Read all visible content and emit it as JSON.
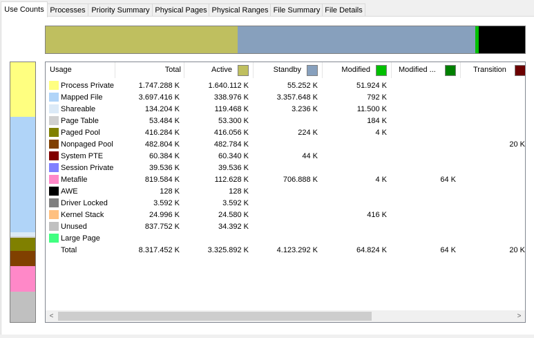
{
  "tabs": [
    {
      "label": "Use Counts",
      "active": true
    },
    {
      "label": "Processes"
    },
    {
      "label": "Priority Summary"
    },
    {
      "label": "Physical Pages"
    },
    {
      "label": "Physical Ranges"
    },
    {
      "label": "File Summary"
    },
    {
      "label": "File Details"
    }
  ],
  "usage_bar": [
    {
      "name": "Active",
      "fraction": 0.4,
      "color": "#bfbf5f"
    },
    {
      "name": "Standby",
      "fraction": 0.496,
      "color": "#87a0bd"
    },
    {
      "name": "Modified",
      "fraction": 0.008,
      "color": "#00c000"
    },
    {
      "name": "Free",
      "fraction": 0.096,
      "color": "#000000"
    }
  ],
  "side_bar": [
    {
      "name": "Process Private",
      "fraction": 0.21,
      "color": "#ffff80"
    },
    {
      "name": "Mapped File",
      "fraction": 0.444,
      "color": "#b0d4f8"
    },
    {
      "name": "Shareable",
      "fraction": 0.016,
      "color": "#dceaf7"
    },
    {
      "name": "Page Table",
      "fraction": 0.006,
      "color": "#d0d0d0"
    },
    {
      "name": "Paged Pool",
      "fraction": 0.05,
      "color": "#808000"
    },
    {
      "name": "Nonpaged Pool",
      "fraction": 0.058,
      "color": "#804000"
    },
    {
      "name": "Metafile",
      "fraction": 0.098,
      "color": "#ff88c8"
    },
    {
      "name": "Unused",
      "fraction": 0.118,
      "color": "#c0c0c0"
    }
  ],
  "columns": [
    {
      "label": "Usage",
      "swatch": null
    },
    {
      "label": "Total",
      "swatch": null
    },
    {
      "label": "Active",
      "swatch": "#bfbf5f"
    },
    {
      "label": "Standby",
      "swatch": "#87a0bd"
    },
    {
      "label": "Modified",
      "swatch": "#00c000"
    },
    {
      "label": "Modified ...",
      "swatch": "#008000"
    },
    {
      "label": "Transition",
      "swatch": "#6b0000"
    }
  ],
  "rows": [
    {
      "name": "Process Private",
      "color": "#ffff80",
      "total": "1.747.288 K",
      "active": "1.640.112 K",
      "standby": "55.252 K",
      "modified": "51.924 K",
      "modnw": "",
      "transition": ""
    },
    {
      "name": "Mapped File",
      "color": "#b0d4f8",
      "total": "3.697.416 K",
      "active": "338.976 K",
      "standby": "3.357.648 K",
      "modified": "792 K",
      "modnw": "",
      "transition": ""
    },
    {
      "name": "Shareable",
      "color": "#dceaf7",
      "total": "134.204 K",
      "active": "119.468 K",
      "standby": "3.236 K",
      "modified": "11.500 K",
      "modnw": "",
      "transition": ""
    },
    {
      "name": "Page Table",
      "color": "#d0d0d0",
      "total": "53.484 K",
      "active": "53.300 K",
      "standby": "",
      "modified": "184 K",
      "modnw": "",
      "transition": ""
    },
    {
      "name": "Paged Pool",
      "color": "#808000",
      "total": "416.284 K",
      "active": "416.056 K",
      "standby": "224 K",
      "modified": "4 K",
      "modnw": "",
      "transition": ""
    },
    {
      "name": "Nonpaged Pool",
      "color": "#804000",
      "total": "482.804 K",
      "active": "482.784 K",
      "standby": "",
      "modified": "",
      "modnw": "",
      "transition": "20 K"
    },
    {
      "name": "System PTE",
      "color": "#800000",
      "total": "60.384 K",
      "active": "60.340 K",
      "standby": "44 K",
      "modified": "",
      "modnw": "",
      "transition": ""
    },
    {
      "name": "Session Private",
      "color": "#8080ff",
      "total": "39.536 K",
      "active": "39.536 K",
      "standby": "",
      "modified": "",
      "modnw": "",
      "transition": ""
    },
    {
      "name": "Metafile",
      "color": "#ff88c8",
      "total": "819.584 K",
      "active": "112.628 K",
      "standby": "706.888 K",
      "modified": "4 K",
      "modnw": "64 K",
      "transition": ""
    },
    {
      "name": "AWE",
      "color": "#000000",
      "total": "128 K",
      "active": "128 K",
      "standby": "",
      "modified": "",
      "modnw": "",
      "transition": ""
    },
    {
      "name": "Driver Locked",
      "color": "#808080",
      "total": "3.592 K",
      "active": "3.592 K",
      "standby": "",
      "modified": "",
      "modnw": "",
      "transition": ""
    },
    {
      "name": "Kernel Stack",
      "color": "#ffc080",
      "total": "24.996 K",
      "active": "24.580 K",
      "standby": "",
      "modified": "416 K",
      "modnw": "",
      "transition": ""
    },
    {
      "name": "Unused",
      "color": "#c0c0c0",
      "total": "837.752 K",
      "active": "34.392 K",
      "standby": "",
      "modified": "",
      "modnw": "",
      "transition": ""
    },
    {
      "name": "Large Page",
      "color": "#40ff80",
      "total": "",
      "active": "",
      "standby": "",
      "modified": "",
      "modnw": "",
      "transition": ""
    },
    {
      "name": "Total",
      "color": null,
      "total": "8.317.452 K",
      "active": "3.325.892 K",
      "standby": "4.123.292 K",
      "modified": "64.824 K",
      "modnw": "64 K",
      "transition": "20 K"
    }
  ],
  "scrollbar": {
    "left_arrow": "<",
    "right_arrow": ">"
  }
}
